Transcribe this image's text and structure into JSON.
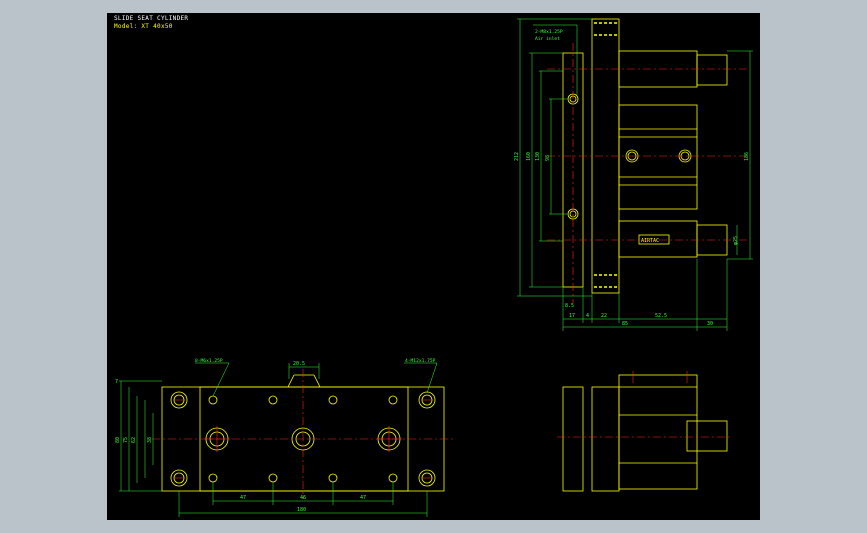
{
  "drawing": {
    "title": "SLIDE SEAT CYLINDER",
    "subtitle": "Model: XT 40x50",
    "colors": {
      "background": "#000000",
      "outline": "#ffff00",
      "dimension": "#33ff33",
      "centerline": "#ff2222",
      "frame": "#b9c3c9"
    }
  },
  "top_view": {
    "note_left": "8-M6x1.25P",
    "note_right": "4-M12x1.75P",
    "dim_top": "20.5",
    "dim_left_outer": "80",
    "dim_left_mid": "75",
    "dim_left_inner": "62",
    "dim_left_small": "38",
    "dim_left_top": "7",
    "dim_bottom_a": "47",
    "dim_bottom_b": "46",
    "dim_bottom_c": "47",
    "dim_bottom_total": "180"
  },
  "side_view": {
    "note": "2-M8x1.25P",
    "note_sub": "Air inlet",
    "dim_212": "212",
    "dim_160": "160",
    "dim_130": "130",
    "dim_98": "98",
    "dim_right": "186",
    "dim_dia": "φ25",
    "dim_s": "8.5",
    "dim_bottom_17": "17",
    "dim_bottom_4": "4",
    "dim_bottom_22": "22",
    "dim_bottom_52": "52.5",
    "dim_bottom_85": "85",
    "dim_bottom_30": "30",
    "badge": "AIRTAC"
  }
}
